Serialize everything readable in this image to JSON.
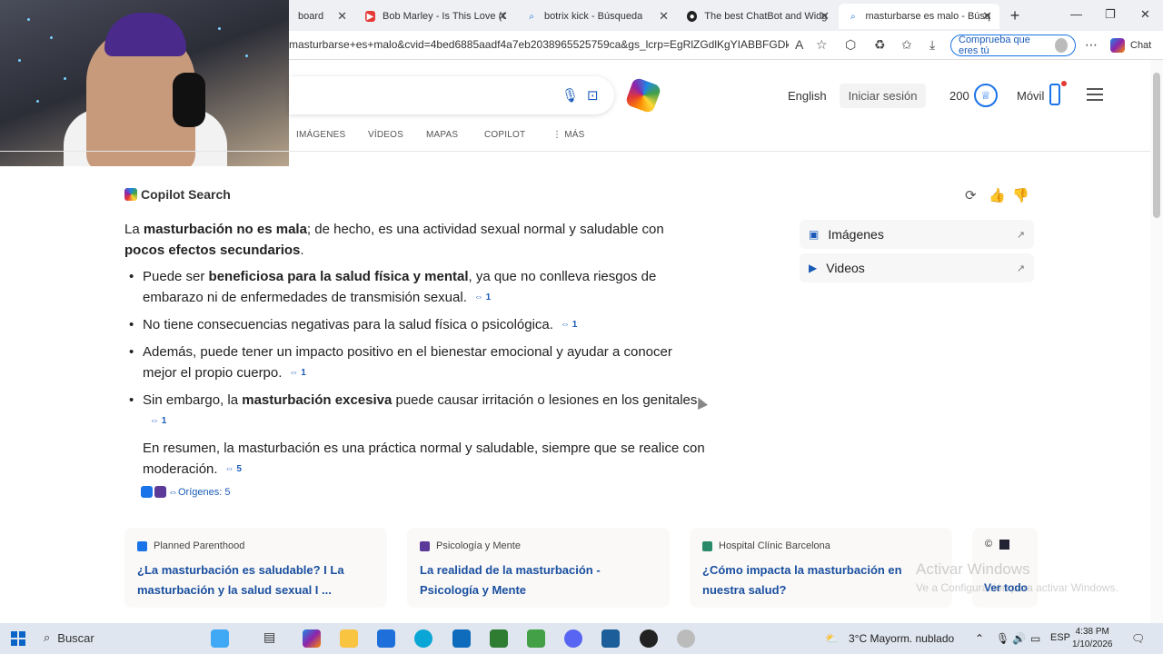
{
  "browser": {
    "tabs": [
      {
        "label": "board",
        "icon": ""
      },
      {
        "label": "Bob Marley - Is This Love (Offi",
        "icon": "youtube-icon"
      },
      {
        "label": "botrix kick - Búsqueda",
        "icon": "search-icon"
      },
      {
        "label": "The best ChatBot and Widget",
        "icon": "chatbot-icon"
      },
      {
        "label": "masturbarse es malo - Búsqu",
        "icon": "search-icon"
      }
    ],
    "url": "masturbarse+es+malo&cvid=4bed6885aadf4a7eb2038965525759ca&gs_lcrp=EgRlZGdlKgYIABBFGDkyBg...",
    "verify_button": "Comprueba que eres tú",
    "chat_button": "Chat"
  },
  "header": {
    "language": "English",
    "signin": "Iniciar sesión",
    "points": "200",
    "mobile": "Móvil",
    "nav": [
      "IMÁGENES",
      "VÍDEOS",
      "MAPAS",
      "COPILOT",
      "MÁS"
    ]
  },
  "copilot": {
    "title": "Copilot Search",
    "intro_parts": [
      "La ",
      "masturbación no es mala",
      "; de hecho, es una actividad sexual normal y saludable con ",
      "pocos efectos secundarios",
      "."
    ],
    "bullets": [
      {
        "parts": [
          "Puede ser ",
          "beneficiosa para la salud física y mental",
          ", ya que no conlleva riesgos de embarazo ni de enfermedades de transmisión sexual."
        ],
        "cite": "1"
      },
      {
        "parts": [
          "No tiene consecuencias negativas para la salud física o psicológica.",
          "",
          ""
        ],
        "cite": "1"
      },
      {
        "parts": [
          "Además, puede tener un impacto positivo en el bienestar emocional y ayudar a conocer mejor el propio cuerpo.",
          "",
          ""
        ],
        "cite": "1"
      },
      {
        "parts": [
          "Sin embargo, la ",
          "masturbación excesiva",
          " puede causar irritación o lesiones en los genitales."
        ],
        "cite": "1"
      }
    ],
    "summary": "En resumen, la masturbación es una práctica normal y saludable, siempre que se realice con moderación.",
    "summary_cite": "5",
    "origins": "Orígenes: 5"
  },
  "sidebar": {
    "items": [
      {
        "label": "Imágenes",
        "icon": "image-icon"
      },
      {
        "label": "Videos",
        "icon": "video-icon"
      }
    ]
  },
  "cards": [
    {
      "source": "Planned Parenthood",
      "title": "¿La masturbación es saludable? I La masturbación y la salud sexual I ...",
      "color": "#1a73e8"
    },
    {
      "source": "Psicología y Mente",
      "title": "La realidad de la masturbación - Psicología y Mente",
      "color": "#5b3a9a"
    },
    {
      "source": "Hospital Clínic Barcelona",
      "title": "¿Cómo impacta la masturbación en nuestra salud?",
      "color": "#2a8a6a"
    }
  ],
  "see_all": "Ver todo",
  "watermark": {
    "line1": "Activar Windows",
    "line2": "Ve a Configuración para activar Windows."
  },
  "taskbar": {
    "search": "Buscar",
    "weather": "3°C  Mayorm. nublado",
    "lang": "ESP",
    "time": "4:38 PM",
    "date": "1/10/2026"
  }
}
